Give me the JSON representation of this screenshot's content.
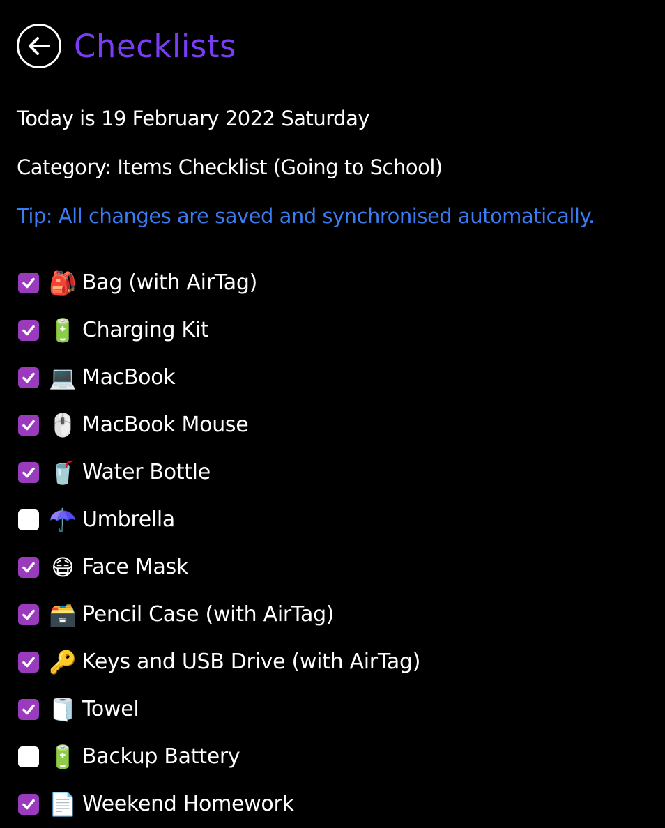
{
  "header": {
    "title": "Checklists",
    "back_icon": "arrow-left-circle-icon",
    "title_color": "#7a3cf5"
  },
  "info": {
    "date_line": "Today is 19 February 2022 Saturday",
    "category_line": "Category: Items Checklist (Going to School)",
    "tip_line": "Tip: All changes are saved and synchronised automatically.",
    "tip_color": "#3a7cf2"
  },
  "checkbox_color": "#9a3bbd",
  "items": [
    {
      "emoji": "🎒",
      "icon": "backpack-icon",
      "label": "Bag (with AirTag)",
      "checked": true
    },
    {
      "emoji": "🔋",
      "icon": "battery-icon",
      "label": "Charging Kit",
      "checked": true
    },
    {
      "emoji": "💻",
      "icon": "laptop-icon",
      "label": "MacBook",
      "checked": true
    },
    {
      "emoji": "🖱️",
      "icon": "mouse-icon",
      "label": "MacBook Mouse",
      "checked": true
    },
    {
      "emoji": "🥤",
      "icon": "cup-with-straw-icon",
      "label": "Water Bottle",
      "checked": true
    },
    {
      "emoji": "☂️",
      "icon": "umbrella-icon",
      "label": "Umbrella",
      "checked": false
    },
    {
      "emoji": "😷",
      "icon": "face-mask-icon",
      "label": "Face Mask",
      "checked": true
    },
    {
      "emoji": "🗃️",
      "icon": "card-file-box-icon",
      "label": "Pencil Case (with AirTag)",
      "checked": true
    },
    {
      "emoji": "🔑",
      "icon": "key-icon",
      "label": "Keys and USB Drive (with AirTag)",
      "checked": true
    },
    {
      "emoji": "🧻",
      "icon": "paper-roll-icon",
      "label": "Towel",
      "checked": true
    },
    {
      "emoji": "🔋",
      "icon": "battery-icon",
      "label": "Backup Battery",
      "checked": false
    },
    {
      "emoji": "📄",
      "icon": "document-icon",
      "label": "Weekend Homework",
      "checked": true
    }
  ]
}
